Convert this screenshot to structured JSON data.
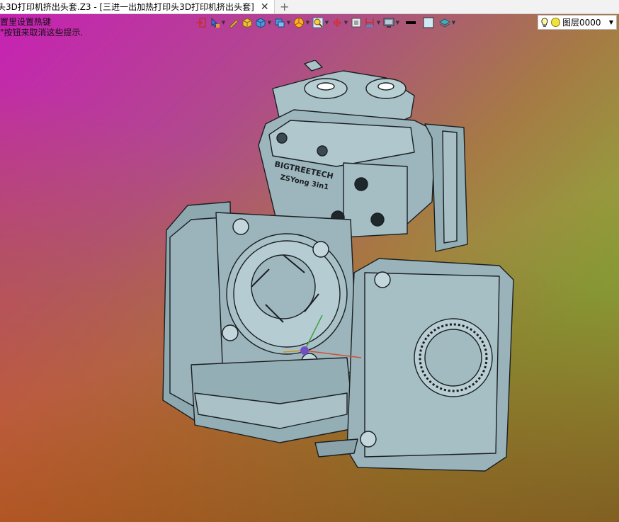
{
  "tabs": [
    {
      "label": "头3D打印机挤出头套.Z3 - [三进一出加热打印头3D打印机挤出头套]",
      "active": true
    }
  ],
  "hints": [
    "置里设置热键",
    "\"按钮来取消这些提示."
  ],
  "toolbar": {
    "icons": [
      "import-icon",
      "select-filter-icon",
      "pen-icon",
      "box-shade-icon",
      "cube-view-icon",
      "display-mode-icon",
      "color-wheel-icon",
      "zoom-icon",
      "axis-icon",
      "frame-icon",
      "section-icon",
      "monitor-icon",
      "line-style-icon",
      "color-swatch-icon",
      "layer-stack-icon"
    ]
  },
  "layer": {
    "name": "图层0000"
  },
  "model": {
    "label_brand": "BIGTREETECH",
    "label_model": "ZSYong 3in1"
  },
  "colors": {
    "part": "#9fb8bf",
    "edge": "#1a1f22"
  }
}
